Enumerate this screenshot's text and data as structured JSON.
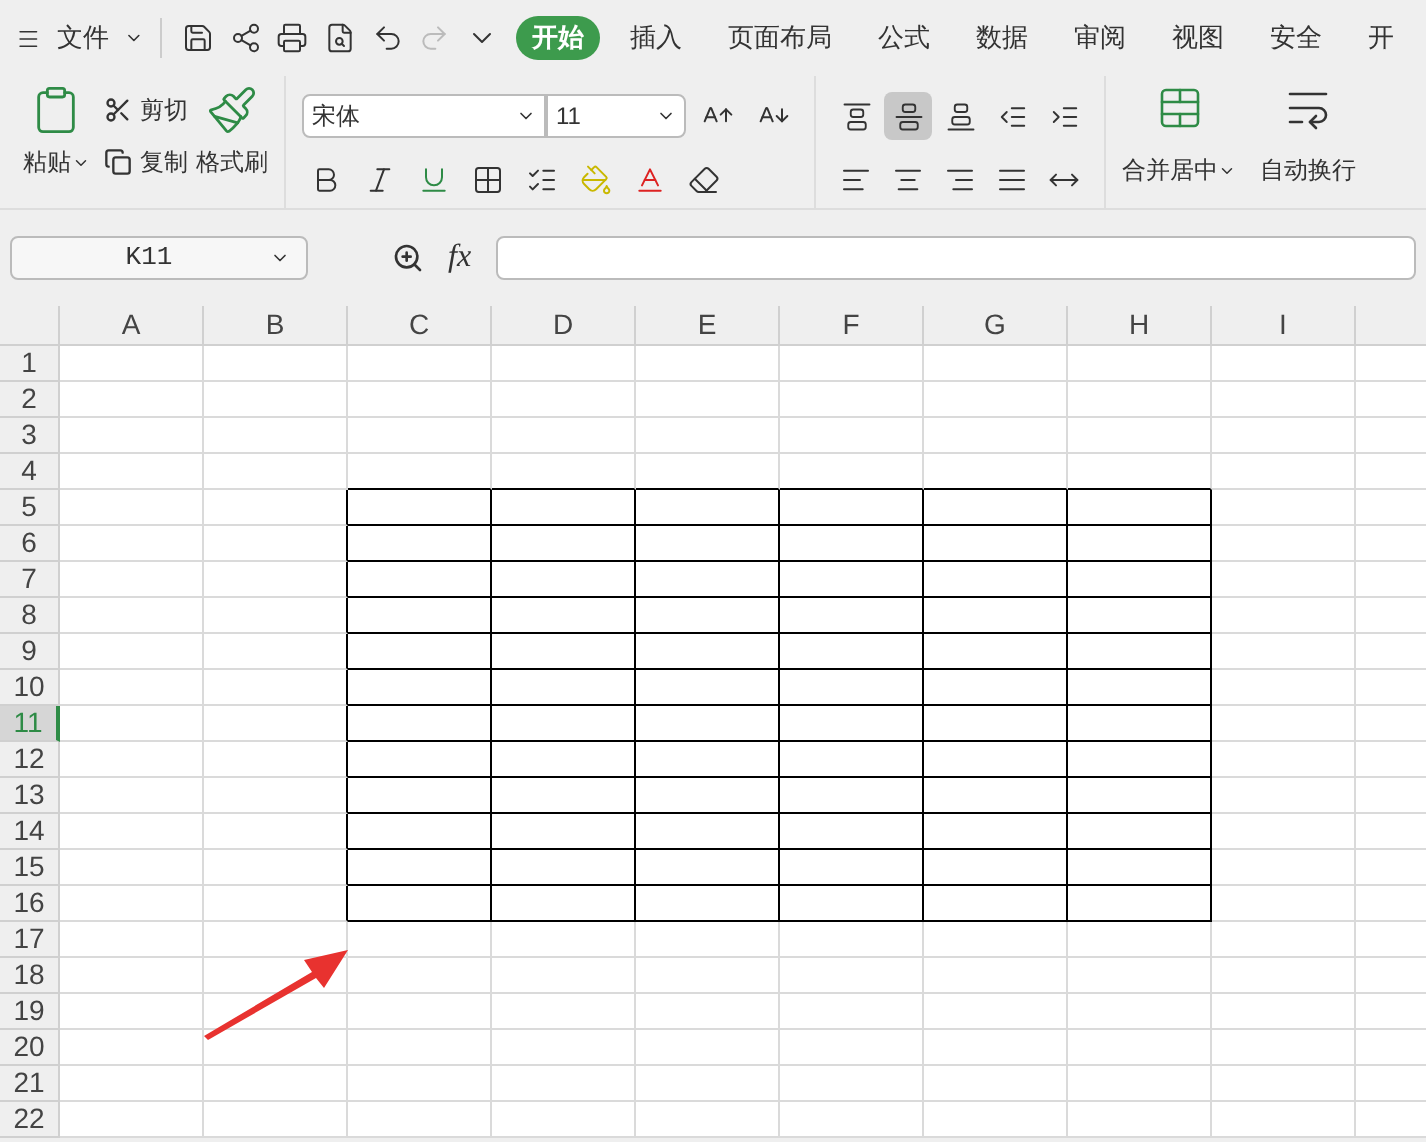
{
  "menu_bar": {
    "file_menu": "文件",
    "tabs": [
      {
        "label": "开始",
        "selected": true
      },
      {
        "label": "插入",
        "selected": false
      },
      {
        "label": "页面布局",
        "selected": false
      },
      {
        "label": "公式",
        "selected": false
      },
      {
        "label": "数据",
        "selected": false
      },
      {
        "label": "审阅",
        "selected": false
      },
      {
        "label": "视图",
        "selected": false
      },
      {
        "label": "安全",
        "selected": false
      },
      {
        "label": "开",
        "selected": false
      }
    ]
  },
  "ribbon": {
    "paste": "粘贴",
    "cut": "剪切",
    "copy": "复制",
    "format_painter": "格式刷",
    "font_name": "宋体",
    "font_size": "11",
    "align_buttons": [
      {
        "kind": "top",
        "selected": false
      },
      {
        "kind": "middle",
        "selected": true
      },
      {
        "kind": "bottom",
        "selected": false
      },
      {
        "kind": "outdent",
        "selected": false
      },
      {
        "kind": "indent",
        "selected": false
      }
    ],
    "merge_center": "合并居中",
    "wrap_text": "自动换行"
  },
  "formula_bar": {
    "name_box": "K11",
    "fx": "fx"
  },
  "sheet": {
    "columns": [
      {
        "label": "A",
        "bordered": false
      },
      {
        "label": "B",
        "bordered": false
      },
      {
        "label": "C",
        "bordered": true
      },
      {
        "label": "D",
        "bordered": true
      },
      {
        "label": "E",
        "bordered": true
      },
      {
        "label": "F",
        "bordered": true
      },
      {
        "label": "G",
        "bordered": true
      },
      {
        "label": "H",
        "bordered": true
      },
      {
        "label": "I",
        "bordered": false
      }
    ],
    "rows": [
      {
        "label": "1",
        "selected": false,
        "bordered": false
      },
      {
        "label": "2",
        "selected": false,
        "bordered": false
      },
      {
        "label": "3",
        "selected": false,
        "bordered": false
      },
      {
        "label": "4",
        "selected": false,
        "bordered": false
      },
      {
        "label": "5",
        "selected": false,
        "bordered": true
      },
      {
        "label": "6",
        "selected": false,
        "bordered": true
      },
      {
        "label": "7",
        "selected": false,
        "bordered": true
      },
      {
        "label": "8",
        "selected": false,
        "bordered": true
      },
      {
        "label": "9",
        "selected": false,
        "bordered": true
      },
      {
        "label": "10",
        "selected": false,
        "bordered": true
      },
      {
        "label": "11",
        "selected": true,
        "bordered": true
      },
      {
        "label": "12",
        "selected": false,
        "bordered": true
      },
      {
        "label": "13",
        "selected": false,
        "bordered": true
      },
      {
        "label": "14",
        "selected": false,
        "bordered": true
      },
      {
        "label": "15",
        "selected": false,
        "bordered": true
      },
      {
        "label": "16",
        "selected": false,
        "bordered": true
      },
      {
        "label": "17",
        "selected": false,
        "bordered": false
      },
      {
        "label": "18",
        "selected": false,
        "bordered": false
      },
      {
        "label": "19",
        "selected": false,
        "bordered": false
      },
      {
        "label": "20",
        "selected": false,
        "bordered": false
      },
      {
        "label": "21",
        "selected": false,
        "bordered": false
      },
      {
        "label": "22",
        "selected": false,
        "bordered": false
      }
    ]
  }
}
